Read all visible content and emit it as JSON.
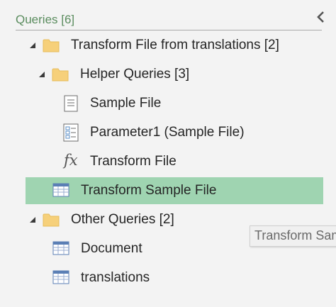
{
  "pane": {
    "title": "Queries [6]",
    "accent": "#5a8c5e",
    "selected_color": "#9fd4b1",
    "collapse_icon": "chevron-left-icon"
  },
  "tree": {
    "group1": {
      "label": "Transform File from translations [2]",
      "icon": "folder-icon",
      "expanded": true,
      "helper": {
        "label": "Helper Queries [3]",
        "icon": "folder-icon",
        "expanded": true,
        "items": [
          {
            "label": "Sample File",
            "icon": "document-icon"
          },
          {
            "label": "Parameter1 (Sample File)",
            "icon": "parameter-icon"
          },
          {
            "label": "Transform File",
            "icon": "function-icon"
          }
        ]
      },
      "transform_sample": {
        "label": "Transform Sample File",
        "icon": "table-icon",
        "selected": true
      }
    },
    "group2": {
      "label": "Other Queries [2]",
      "icon": "folder-icon",
      "expanded": true,
      "items": [
        {
          "label": "Document",
          "icon": "table-icon"
        },
        {
          "label": "translations",
          "icon": "table-icon"
        }
      ]
    }
  },
  "tooltip": {
    "text": "Transform Sample File"
  }
}
